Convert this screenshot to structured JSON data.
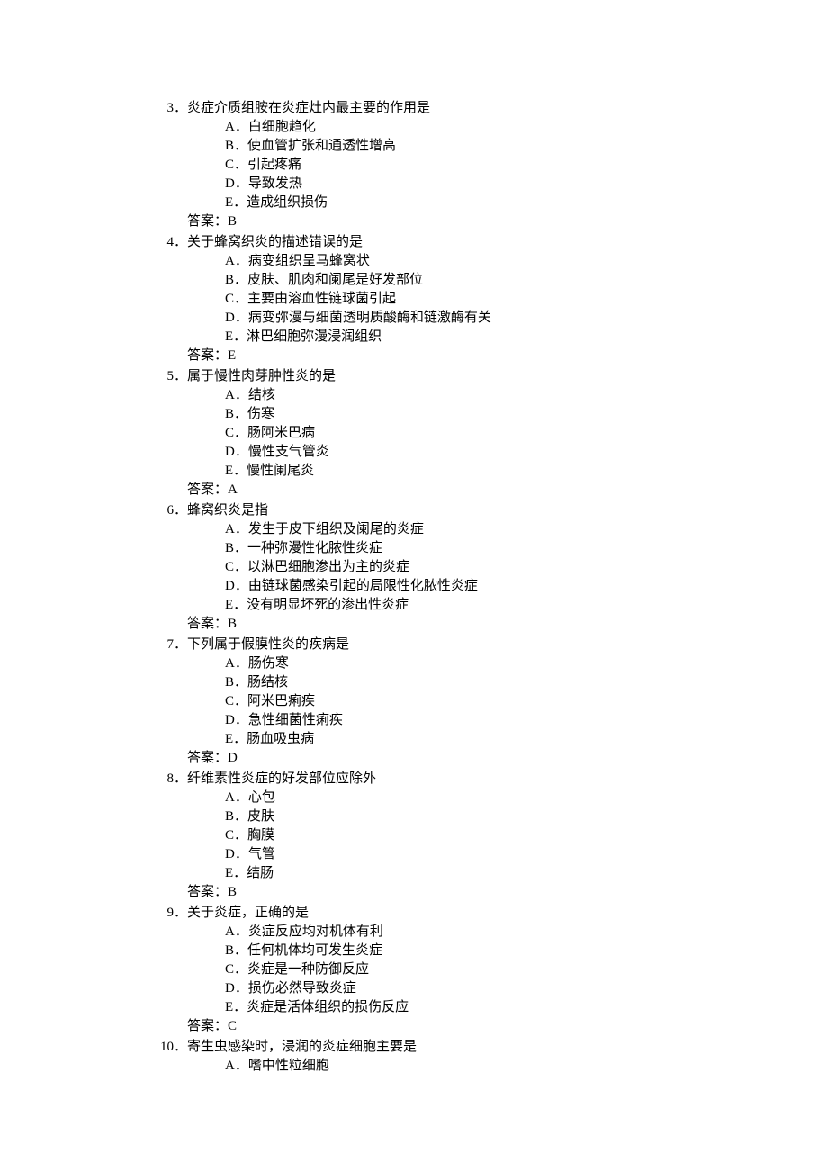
{
  "questions": [
    {
      "num": "3．",
      "stem": "炎症介质组胺在炎症灶内最主要的作用是",
      "options": [
        "A．白细胞趋化",
        "B．使血管扩张和通透性增高",
        "C．引起疼痛",
        "D．导致发热",
        "E．造成组织损伤"
      ],
      "answer": "答案：B"
    },
    {
      "num": "4．",
      "stem": "关于蜂窝织炎的描述错误的是",
      "options": [
        "A．病变组织呈马蜂窝状",
        "B．皮肤、肌肉和阑尾是好发部位",
        "C．主要由溶血性链球菌引起",
        "D．病变弥漫与细菌透明质酸酶和链激酶有关",
        "E．淋巴细胞弥漫浸润组织"
      ],
      "answer": "答案：E"
    },
    {
      "num": "5．",
      "stem": "属于慢性肉芽肿性炎的是",
      "options": [
        "A．结核",
        "B．伤寒",
        "C．肠阿米巴病",
        "D．慢性支气管炎",
        "E．慢性阑尾炎"
      ],
      "answer": "答案：A"
    },
    {
      "num": "6．",
      "stem": "蜂窝织炎是指",
      "options": [
        "A．发生于皮下组织及阑尾的炎症",
        "B．一种弥漫性化脓性炎症",
        "C．以淋巴细胞渗出为主的炎症",
        "D．由链球菌感染引起的局限性化脓性炎症",
        "E．没有明显坏死的渗出性炎症"
      ],
      "answer": "答案：B"
    },
    {
      "num": "7．",
      "stem": "下列属于假膜性炎的疾病是",
      "options": [
        "A．肠伤寒",
        "B．肠结核",
        "C．阿米巴痢疾",
        "D．急性细菌性痢疾",
        "E．肠血吸虫病"
      ],
      "answer": "答案：D"
    },
    {
      "num": "8．",
      "stem": "纤维素性炎症的好发部位应除外",
      "options": [
        "A．心包",
        "B．皮肤",
        "C．胸膜",
        "D．气管",
        "E．结肠"
      ],
      "answer": "答案：B"
    },
    {
      "num": "9．",
      "stem": "关于炎症，正确的是",
      "options": [
        "A．炎症反应均对机体有利",
        "B．任何机体均可发生炎症",
        "C．炎症是一种防御反应",
        "D．损伤必然导致炎症",
        "E．炎症是活体组织的损伤反应"
      ],
      "answer": "答案：C"
    },
    {
      "num": "10．",
      "stem": "寄生虫感染时，浸润的炎症细胞主要是",
      "options": [
        "A．嗜中性粒细胞"
      ],
      "answer": ""
    }
  ]
}
